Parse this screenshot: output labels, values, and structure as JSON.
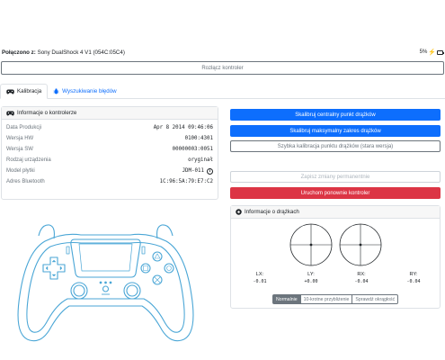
{
  "header": {
    "connected_label": "Połączono z:",
    "device_name": "Sony DualShock 4 V1 (054C:05C4)",
    "battery": "5%"
  },
  "disconnect_label": "Rozłącz kontroler",
  "tabs": [
    {
      "label": "Kalibracja",
      "icon": "gamepad-icon"
    },
    {
      "label": "Wyszukiwanie błędów",
      "icon": "bug-icon"
    }
  ],
  "info_card": {
    "title": "Informacje o kontrolerze",
    "rows": [
      {
        "label": "Data Produkcji",
        "value": "Apr 8 2014 09:46:06"
      },
      {
        "label": "Wersja HW",
        "value": "0100:4301"
      },
      {
        "label": "Wersja SW",
        "value": "00000003:0051"
      },
      {
        "label": "Rodzaj urządzenia",
        "value": "oryginał"
      },
      {
        "label": "Model płytki",
        "value": "JDM-011"
      },
      {
        "label": "Adres Bluetooth",
        "value": "1C:96:5A:79:E7:C2"
      }
    ]
  },
  "actions": {
    "calibrate_center": "Skalibruj centralny punkt drążków",
    "calibrate_range": "Skalibruj maksymalny zakres drążków",
    "quick_calibrate": "Szybka kalibracja punktu drążków (stara wersja)",
    "save_permanent": "Zapisz zmiany permanentnie",
    "restart": "Uruchom ponownie kontroler"
  },
  "sticks_card": {
    "title": "Informacje o drążkach",
    "axes": [
      {
        "label": "LX:",
        "value": "-0.01"
      },
      {
        "label": "LY:",
        "value": "+0.00"
      },
      {
        "label": "RX:",
        "value": "-0.04"
      },
      {
        "label": "RY:",
        "value": "-0.04"
      }
    ],
    "modes": [
      "Normalnie",
      "10-krotne przybliżenie",
      "Sprawdź okrągłość"
    ]
  },
  "colors": {
    "primary": "#0d6efd",
    "danger": "#dc3545",
    "secondary": "#6c757d",
    "controller_outline": "#4aa6d6"
  }
}
